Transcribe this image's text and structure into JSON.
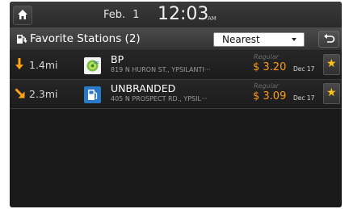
{
  "statusbar": {
    "month": "Feb.",
    "day": "1",
    "time": "12:03",
    "ampm": "AM"
  },
  "titlebar": {
    "title": "Favorite Stations (2)",
    "sort_value": "Nearest"
  },
  "stations": [
    {
      "direction": "south",
      "distance": "1.4mi",
      "name": "BP",
      "address": "819 N HURON ST., YPSILANTI···",
      "grade": "Regular",
      "price": "$ 3.20",
      "date": "Dec 17"
    },
    {
      "direction": "southeast",
      "distance": "2.3mi",
      "name": "UNBRANDED",
      "address": "405 N PROSPECT RD., YPSIL···",
      "grade": "Regular",
      "price": "$ 3.09",
      "date": "Dec 17"
    }
  ],
  "colors": {
    "price": "#ff9a1a",
    "direction_arrow": "#ffa21a",
    "star": "#ffc21a"
  },
  "icons": {
    "home": "home-icon",
    "favorites": "favorite-stations-icon",
    "back": "back-icon",
    "bp_logo": "bp-logo-icon",
    "unbranded": "fuel-pump-icon",
    "star": "star-icon"
  }
}
